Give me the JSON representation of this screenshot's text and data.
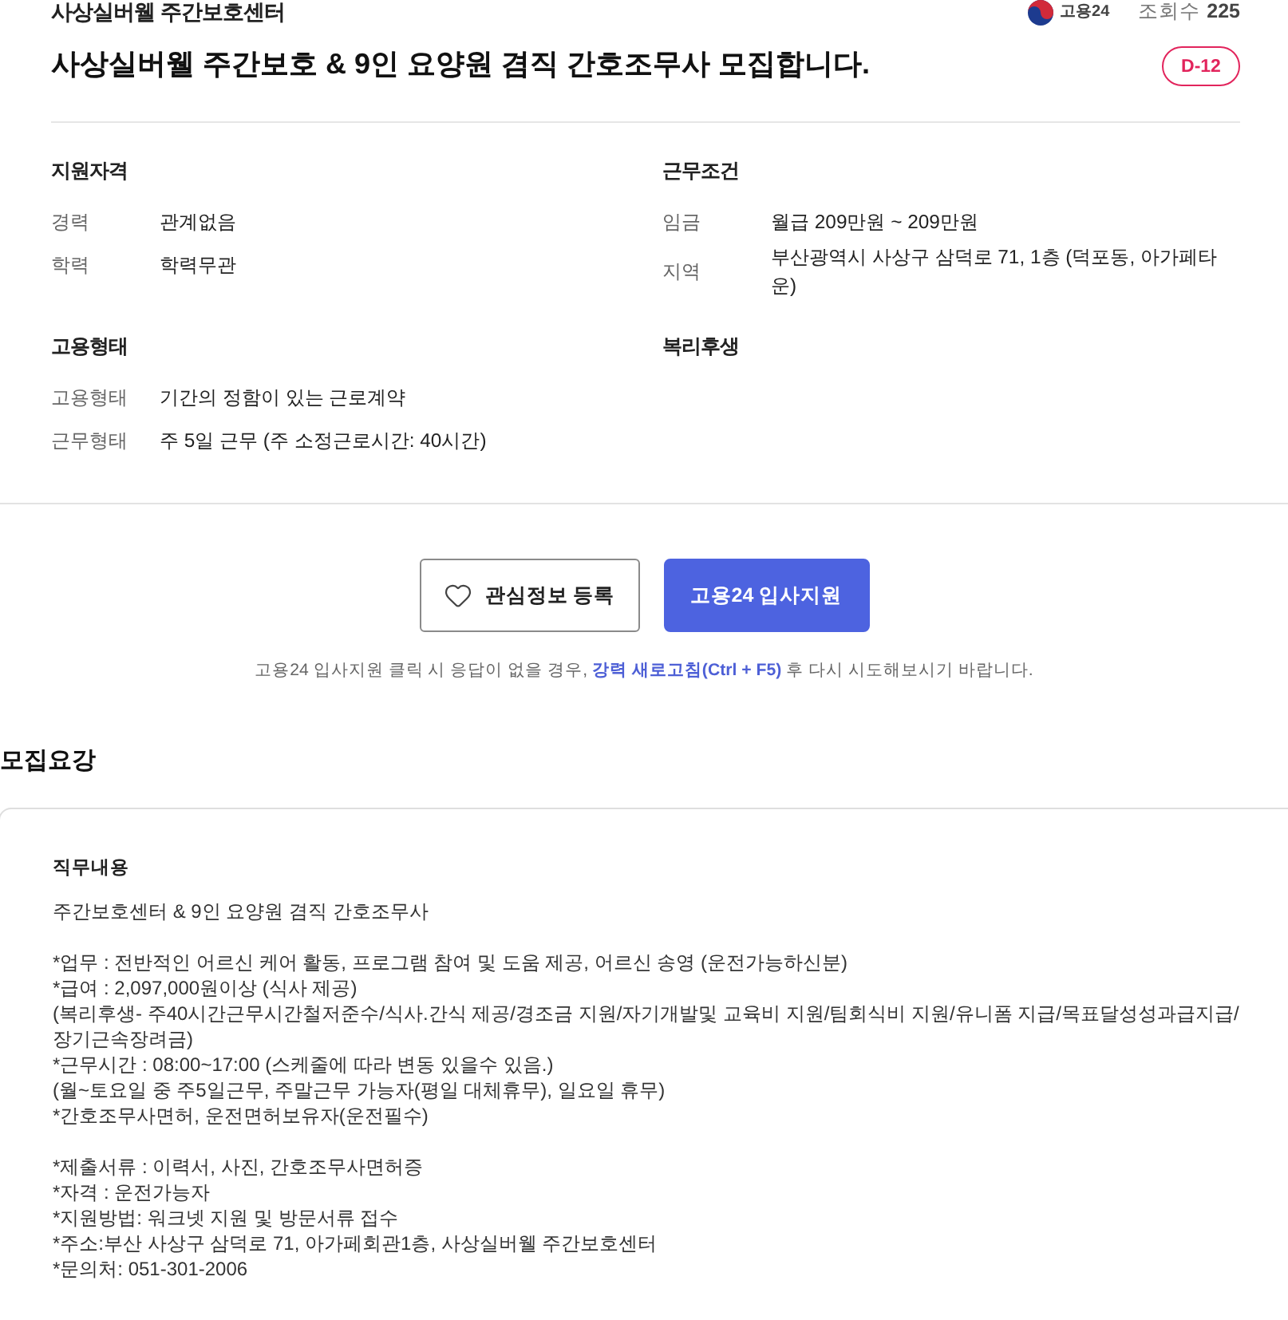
{
  "header": {
    "company": "사상실버웰 주간보호센터",
    "source": {
      "name": "고용24"
    },
    "views": {
      "label": "조회수",
      "count": "225"
    },
    "title": "사상실버웰 주간보호 & 9인 요양원 겸직 간호조무사 모집합니다.",
    "badge": "D-12"
  },
  "conditions": [
    {
      "heading": "지원자격",
      "rows": [
        {
          "label": "경력",
          "value": "관계없음"
        },
        {
          "label": "학력",
          "value": "학력무관"
        }
      ]
    },
    {
      "heading": "근무조건",
      "rows": [
        {
          "label": "임금",
          "value": "월급 209만원 ~ 209만원"
        },
        {
          "label": "지역",
          "value": "부산광역시 사상구 삼덕로 71, 1층 (덕포동, 아가페타운)"
        }
      ]
    },
    {
      "heading": "고용형태",
      "rows": [
        {
          "label": "고용형태",
          "value": "기간의 정함이 있는 근로계약"
        },
        {
          "label": "근무형태",
          "value": "주 5일 근무 (주 소정근로시간: 40시간)"
        }
      ]
    },
    {
      "heading": "복리후생"
    }
  ],
  "actions": {
    "buttons": [
      {
        "kind": "outline",
        "label": "관심정보 등록"
      },
      {
        "kind": "primary",
        "label": "고용24 입사지원"
      }
    ],
    "notice": "고용24 입사지원 클릭 시 응답이 없을 경우, **강력 새로고침(Ctrl + F5)** 후 다시 시도해보시기 바랍니다."
  },
  "recruitment": {
    "title": "모집요강",
    "sections": [
      {
        "heading": "직무내용",
        "paragraphs": [
          [
            "주간보호센터 & 9인 요양원 겸직 간호조무사"
          ],
          [
            "*업무 : 전반적인 어르신 케어 활동, 프로그램 참여 및 도움 제공, 어르신 송영 (운전가능하신분)",
            "*급여 : 2,097,000원이상 (식사 제공)",
            "(복리후생- 주40시간근무시간철저준수/식사.간식 제공/경조금 지원/자기개발및 교육비 지원/팀회식비 지원/유니폼 지급/목표달성성과급지급/장기근속장려금)",
            "*근무시간 : 08:00~17:00 (스케줄에 따라 변동 있을수 있음.)",
            "(월~토요일 중 주5일근무, 주말근무 가능자(평일 대체휴무), 일요일 휴무)",
            "*간호조무사면허, 운전면허보유자(운전필수)"
          ],
          [
            "*제출서류 : 이력서, 사진, 간호조무사면허증",
            "*자격 : 운전가능자",
            "*지원방법: 워크넷 지원 및 방문서류 접수",
            "*주소:부산 사상구 삼덕로 71, 아가페회관1층, 사상실버웰 주간보호센터",
            "*문의처: 051-301-2006"
          ]
        ]
      }
    ]
  }
}
